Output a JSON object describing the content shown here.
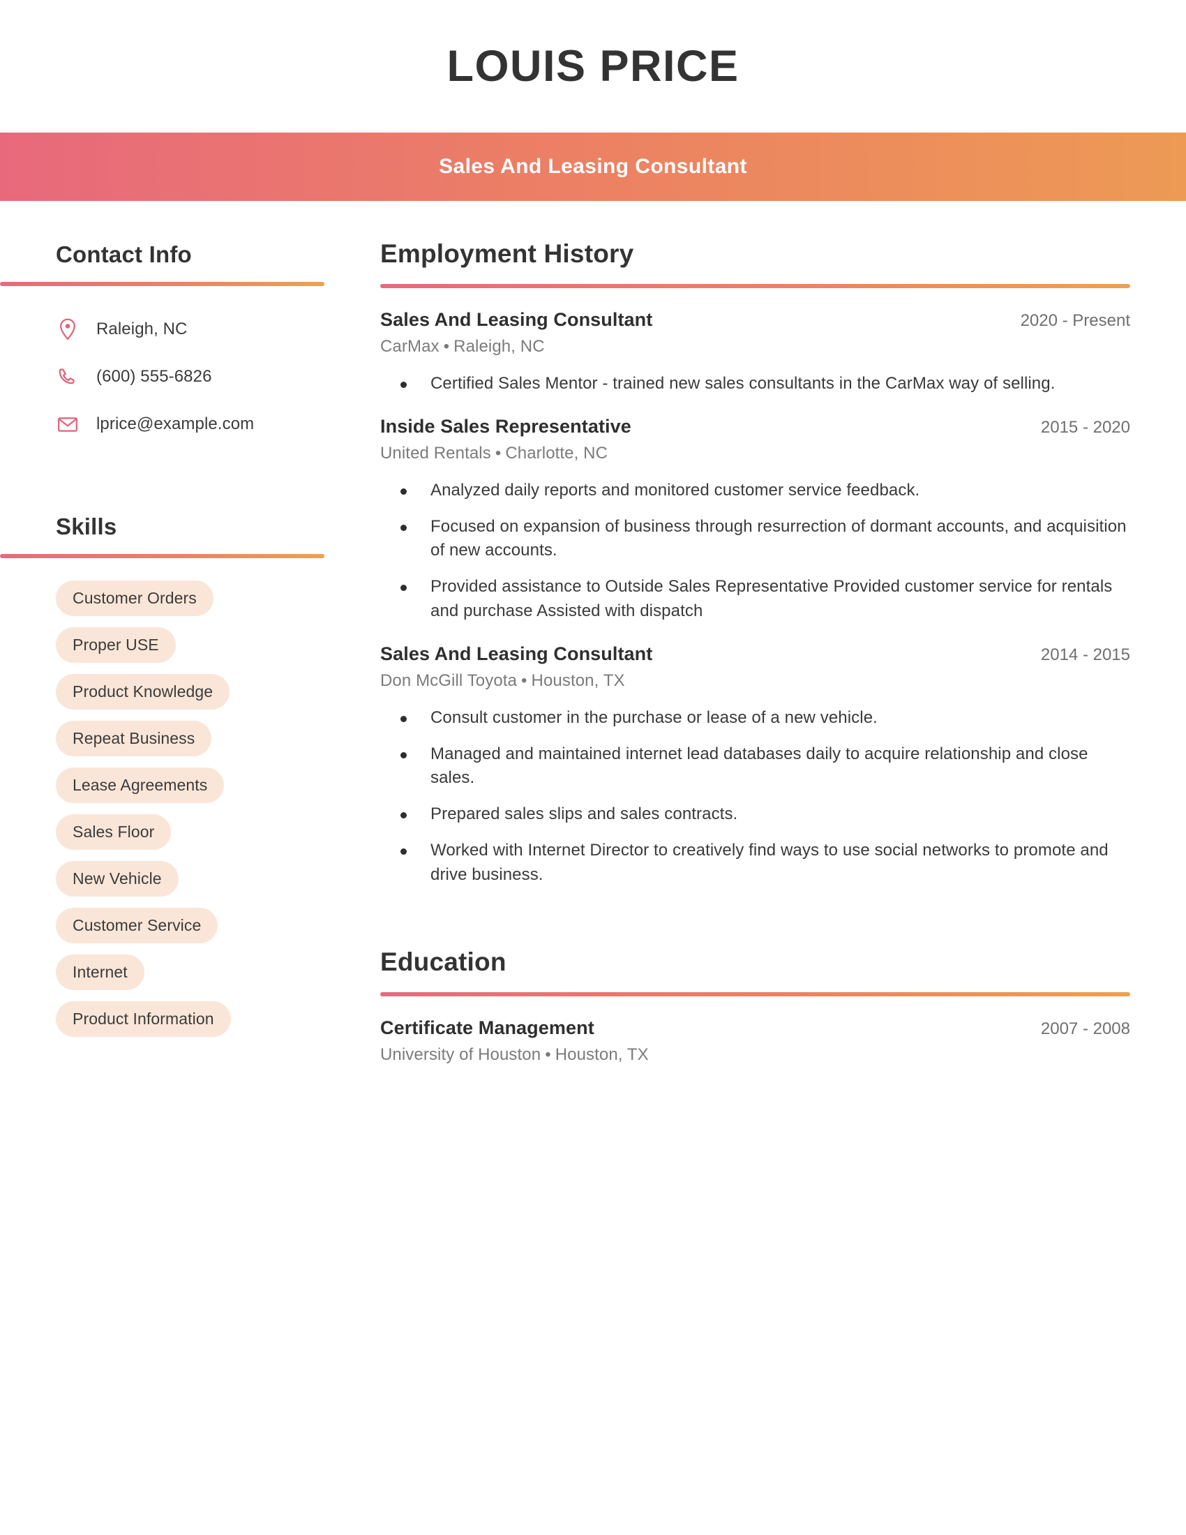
{
  "header": {
    "name": "LOUIS PRICE",
    "title": "Sales And Leasing Consultant",
    "gradient_start": "#e8697c",
    "gradient_end": "#ed9a55"
  },
  "sidebar": {
    "contact": {
      "heading": "Contact Info",
      "items": [
        {
          "icon": "location-pin-icon",
          "text": "Raleigh, NC"
        },
        {
          "icon": "phone-icon",
          "text": "(600) 555-6826"
        },
        {
          "icon": "email-envelope-icon",
          "text": "lprice@example.com"
        }
      ]
    },
    "skills": {
      "heading": "Skills",
      "pill_color": "#fae6d8",
      "items": [
        "Customer Orders",
        "Proper USE",
        "Product Knowledge",
        "Repeat Business",
        "Lease Agreements",
        "Sales Floor",
        "New Vehicle",
        "Customer Service",
        "Internet",
        "Product Information"
      ]
    }
  },
  "main": {
    "employment": {
      "heading": "Employment History",
      "entries": [
        {
          "title": "Sales And Leasing Consultant",
          "dates": "2020 - Present",
          "company": "CarMax",
          "location": "Raleigh, NC",
          "bullets": [
            "Certified Sales Mentor - trained new sales consultants in the CarMax way of selling."
          ]
        },
        {
          "title": "Inside Sales Representative",
          "dates": "2015 - 2020",
          "company": "United Rentals",
          "location": "Charlotte, NC",
          "bullets": [
            "Analyzed daily reports and monitored customer service feedback.",
            "Focused on expansion of business through resurrection of dormant accounts, and acquisition of new accounts.",
            "Provided assistance to Outside Sales Representative Provided customer service for rentals and purchase Assisted with dispatch"
          ]
        },
        {
          "title": "Sales And Leasing Consultant",
          "dates": "2014 - 2015",
          "company": "Don McGill Toyota",
          "location": "Houston, TX",
          "bullets": [
            "Consult customer in the purchase or lease of a new vehicle.",
            "Managed and maintained internet lead databases daily to acquire relationship and close sales.",
            "Prepared sales slips and sales contracts.",
            "Worked with Internet Director to creatively find ways to use social networks to promote and drive business."
          ]
        }
      ]
    },
    "education": {
      "heading": "Education",
      "entries": [
        {
          "title": "Certificate Management",
          "dates": "2007 - 2008",
          "school": "University of Houston",
          "location": "Houston, TX"
        }
      ]
    }
  },
  "separator": "•"
}
